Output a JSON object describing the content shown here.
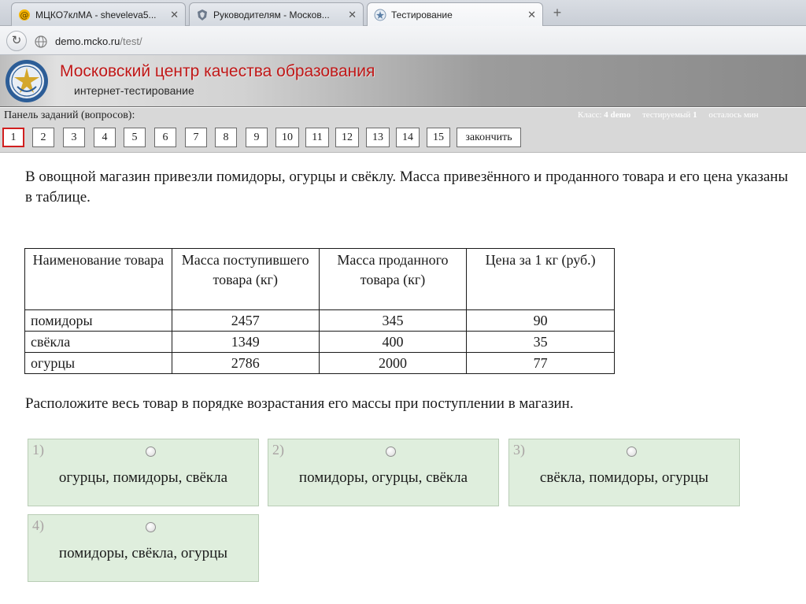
{
  "browser": {
    "tabs": [
      {
        "label": "МЦКО7клМА - sheveleva5...",
        "active": false
      },
      {
        "label": "Руководителям - Москов...",
        "active": false
      },
      {
        "label": "Тестирование",
        "active": true
      }
    ],
    "new_tab_label": "+",
    "url_host": "demo.mcko.ru",
    "url_path": "/test/"
  },
  "header": {
    "title": "Московский центр качества образования",
    "subtitle": "интернет-тестирование"
  },
  "panel": {
    "label": "Панель заданий (вопросов):",
    "status": {
      "class_label": "Класс:",
      "class_value": "4 demo",
      "tested_label": "тестируемый",
      "tested_value": "1",
      "remaining_label": "осталось мин"
    },
    "questions": [
      "1",
      "2",
      "3",
      "4",
      "5",
      "6",
      "7",
      "8",
      "9",
      "10",
      "11",
      "12",
      "13",
      "14",
      "15"
    ],
    "current_question": "1",
    "finish_label": "закончить"
  },
  "question": {
    "text": "В овощной магазин привезли помидоры, огурцы и свёклу. Масса привезённого и проданного товара и его цена указаны в таблице.",
    "table": {
      "headers": [
        "Наименование товара",
        "Масса поступившего товара (кг)",
        "Масса проданного товара (кг)",
        "Цена за 1 кг (руб.)"
      ],
      "rows": [
        [
          "помидоры",
          "2457",
          "345",
          "90"
        ],
        [
          "свёкла",
          "1349",
          "400",
          "35"
        ],
        [
          "огурцы",
          "2786",
          "2000",
          "77"
        ]
      ]
    },
    "instruction": "Расположите весь товар в порядке возрастания его массы при поступлении в магазин."
  },
  "options": [
    {
      "number": "1)",
      "text": "огурцы, помидоры, свёкла"
    },
    {
      "number": "2)",
      "text": "помидоры, огурцы, свёкла"
    },
    {
      "number": "3)",
      "text": "свёкла, помидоры, огурцы"
    },
    {
      "number": "4)",
      "text": "помидоры, свёкла, огурцы"
    }
  ]
}
